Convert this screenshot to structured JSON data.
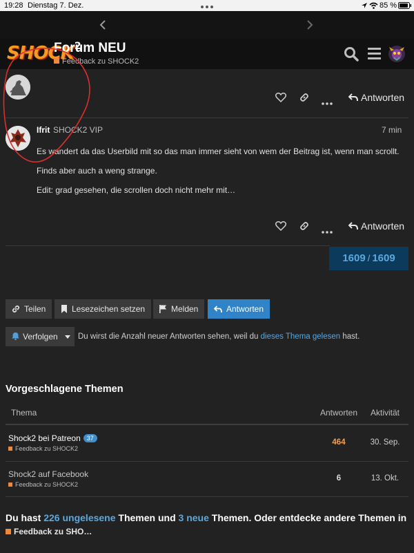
{
  "status_bar": {
    "time": "19:28",
    "date": "Dienstag 7. Dez.",
    "battery": "85 %"
  },
  "header": {
    "logo_text": "SHOCK",
    "logo_sup": "2",
    "title": "Forum NEU",
    "category": "Feedback zu SHOCK2",
    "category_color": "#f0883a"
  },
  "post_top": {
    "reply_label": "Antworten"
  },
  "post": {
    "username": "Ifrit",
    "user_title": "SHOCK2 VIP",
    "time": "7 min",
    "lines": [
      "Es wandert da das Userbild mit so das man immer sieht von wem der Beitrag ist, wenn man scrollt.",
      "Finds aber auch a weng strange.",
      "Edit: grad gesehen, die scrollen doch nicht mehr mit…"
    ],
    "reply_label": "Antworten"
  },
  "progress": {
    "current": "1609",
    "total": "1609"
  },
  "buttons": {
    "share": "Teilen",
    "bookmark": "Lesezeichen setzen",
    "flag": "Melden",
    "reply": "Antworten"
  },
  "notifications": {
    "label": "Verfolgen",
    "note_before": "Du wirst die Anzahl neuer Antworten sehen, weil du ",
    "note_link": "dieses Thema gelesen",
    "note_after": " hast."
  },
  "suggested": {
    "title": "Vorgeschlagene Themen",
    "columns": {
      "topic": "Thema",
      "replies": "Antworten",
      "activity": "Aktivität"
    },
    "rows": [
      {
        "title": "Shock2 bei Patreon",
        "badge": "37",
        "category": "Feedback zu SHOCK2",
        "replies": "464",
        "activity": "30. Sep."
      },
      {
        "title": "Shock2 auf Facebook",
        "badge": "",
        "category": "Feedback zu SHOCK2",
        "replies": "6",
        "activity": "13. Okt."
      }
    ]
  },
  "bottom": {
    "part1": "Du hast ",
    "unread": "226 ungelesene",
    "part2": " Themen und ",
    "new": "3 neue",
    "part3": " Themen. Oder entdecke andere Themen in",
    "category": "Feedback zu SHO…"
  },
  "colors": {
    "accent": "#2f83c6",
    "link": "#5aa8dd",
    "hot_count": "#f0a050",
    "annotation": "#d9302c"
  }
}
